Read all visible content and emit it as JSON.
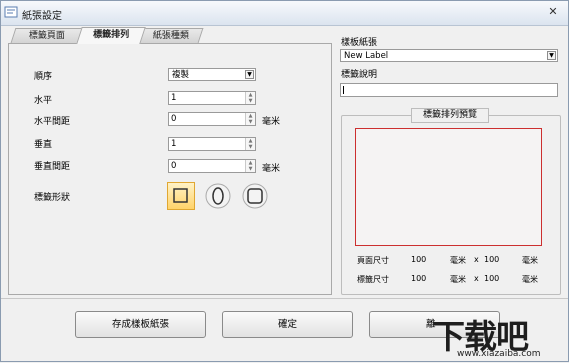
{
  "window": {
    "title": "紙張設定",
    "close_glyph": "✕"
  },
  "tabs": [
    {
      "label": "標籤頁面",
      "active": false
    },
    {
      "label": "標籤排列",
      "active": true
    },
    {
      "label": "紙張種類",
      "active": false
    }
  ],
  "form": {
    "order_label": "順序",
    "order_value": "複製",
    "horizontal_label": "水平",
    "horizontal_value": "1",
    "h_gap_label": "水平間距",
    "h_gap_value": "0",
    "h_gap_unit": "毫米",
    "vertical_label": "垂直",
    "vertical_value": "1",
    "v_gap_label": "垂直間距",
    "v_gap_value": "0",
    "v_gap_unit": "毫米",
    "shape_label": "標籤形狀",
    "shapes": [
      {
        "icon": "square-shape-icon",
        "selected": true
      },
      {
        "icon": "ellipse-shape-icon",
        "selected": false
      },
      {
        "icon": "rounded-square-shape-icon",
        "selected": false
      }
    ]
  },
  "right": {
    "template_label": "樣板紙張",
    "template_value": "New Label",
    "description_label": "標籤說明",
    "description_value": "",
    "preview_title": "標籤排列預覽",
    "page_size_label": "頁面尺寸",
    "page_w": "100",
    "page_unit1": "毫米",
    "page_x": "x",
    "page_h": "100",
    "page_unit2": "毫米",
    "label_size_label": "標籤尺寸",
    "label_w": "100",
    "label_unit1": "毫米",
    "label_x": "x",
    "label_h": "100",
    "label_unit2": "毫米"
  },
  "buttons": {
    "save_template": "存成樣板紙張",
    "ok": "確定",
    "partial": "離"
  },
  "watermark": {
    "main": "下载吧",
    "sub": "www.xiazaiba.com"
  },
  "colors": {
    "preview_border": "#cc2f2f",
    "selected_shape_fill": "#ffd36a"
  }
}
